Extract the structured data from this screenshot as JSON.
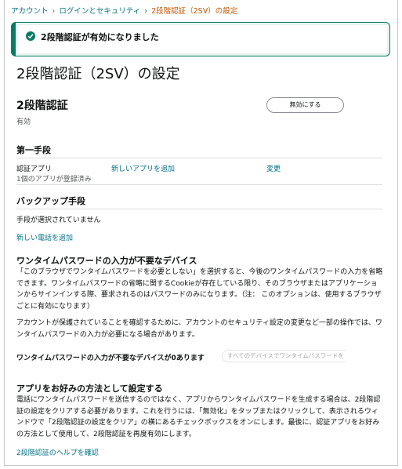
{
  "breadcrumb": {
    "items": [
      "アカウント",
      "ログインとセキュリティ"
    ],
    "current": "2段階認証（2SV）の設定"
  },
  "alert": {
    "message": "2段階認証が有効になりました",
    "color": "#067d62"
  },
  "page": {
    "title": "2段階認証（2SV）の設定"
  },
  "twoStep": {
    "heading": "2段階認証",
    "status": "有効",
    "disable_label": "無効にする"
  },
  "first": {
    "heading": "第一手段",
    "app_label": "認証アプリ",
    "app_sub": "1個のアプリが登録済み",
    "add_app": "新しいアプリを追加",
    "change": "変更"
  },
  "backup": {
    "heading": "バックアップ手段",
    "none": "手段が選択されていません",
    "add_phone": "新しい電話を追加"
  },
  "devices": {
    "heading": "ワンタイムパスワードの入力が不要なデバイス",
    "para1": "「このブラウザでワンタイムパスワードを必要としない」を選択すると、今後のワンタイムパスワードの入力を省略できます。ワンタイムパスワードの省略に関するCookieが存在している限り、そのブラウザまたはアプリケーションからサインインする際、要求されるのはパスワードのみになります。（注： このオプションは、使用するブラウザごとに有効になります）",
    "para2": "アカウントが保護されていることを確認するために、アカウントのセキュリティ設定の変更など一部の操作では、ワンタイムパスワードの入力が必要になる場合があります。",
    "count_text": "ワンタイムパスワードの入力が不要なデバイスが0あります",
    "all_devices_label": "すべてのデバイスでワンタイムパスワードを"
  },
  "preferred": {
    "heading": "アプリをお好みの方法として設定する",
    "para": "電話にワンタイムパスワードを送信するのではなく、アプリからワンタイムパスワードを生成する場合は、2段階認証の設定をクリアする必要があります。これを行うには、「無効化」をタップまたはクリックして、表示されるウィンドウで「2段階認証の設定をクリア」の横にあるチェックボックスをオンにします。最後に、認証アプリをお好みの方法として使用して、2段階認証を再度有効にします。",
    "help_link": "2段階認証のヘルプを確認"
  }
}
